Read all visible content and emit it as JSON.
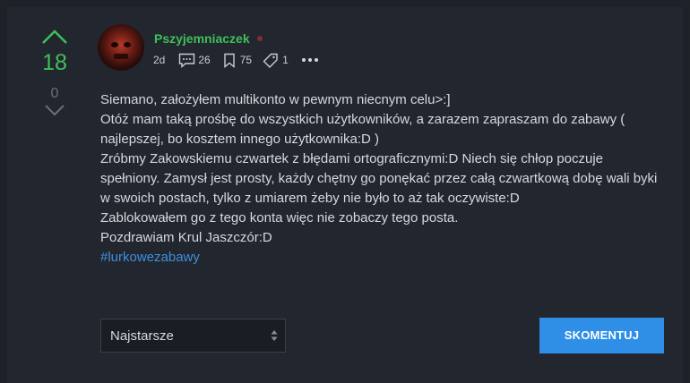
{
  "vote": {
    "score": "18",
    "downvotes": "0"
  },
  "author": {
    "name": "Pszyjemniaczek"
  },
  "meta": {
    "time": "2d",
    "comments": "26",
    "favorites": "75",
    "tags": "1"
  },
  "content": {
    "lines": [
      "Siemano, założyłem multikonto w pewnym niecnym celu>:]",
      "Otóż mam taką prośbę do wszystkich użytkowników, a zarazem zapraszam do zabawy ( najlepszej, bo kosztem innego użytkownika:D )",
      "Zróbmy Zakowskiemu czwartek z błędami ortograficznymi:D Niech się chłop poczuje spełniony. Zamysł jest prosty, każdy chętny go ponękać przez całą czwartkową dobę wali byki w swoich postach, tylko z umiarem żeby nie było to aż tak oczywiste:D",
      "Zablokowałem go z tego konta więc nie zobaczy tego posta.",
      "Pozdrawiam Krul Jaszczór:D"
    ],
    "hashtag": "#lurkowezabawy"
  },
  "sort": {
    "selected": "Najstarsze"
  },
  "comment_button": {
    "label": "SKOMENTUJ"
  },
  "colors": {
    "accent_green": "#3fbf5a",
    "link_blue": "#3f8fe0",
    "button_blue": "#2f8fe6",
    "background": "#22262e"
  }
}
